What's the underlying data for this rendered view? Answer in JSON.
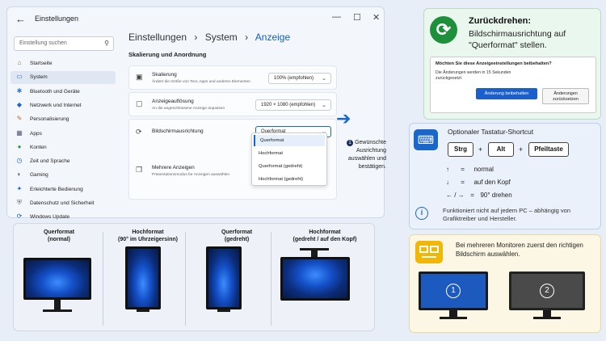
{
  "window": {
    "title": "Einstellungen",
    "back": "←",
    "min": "—",
    "max": "☐",
    "close": "✕"
  },
  "search": {
    "placeholder": "Einstellung suchen",
    "icon": "search-icon"
  },
  "sidebar": {
    "items": [
      {
        "label": "Startseite",
        "icon": "home-icon",
        "color": "#8a6d3b"
      },
      {
        "label": "System",
        "icon": "system-icon",
        "color": "#1a66c9"
      },
      {
        "label": "Bluetooth und Geräte",
        "icon": "bluetooth-icon",
        "color": "#2b7bd6"
      },
      {
        "label": "Netzwerk und Internet",
        "icon": "wifi-icon",
        "color": "#1a66c9"
      },
      {
        "label": "Personalisierung",
        "icon": "brush-icon",
        "color": "#c8662b"
      },
      {
        "label": "Apps",
        "icon": "apps-icon",
        "color": "#5a5a7a"
      },
      {
        "label": "Konten",
        "icon": "account-icon",
        "color": "#2aa052"
      },
      {
        "label": "Zeit und Sprache",
        "icon": "clock-icon",
        "color": "#1a66c9"
      },
      {
        "label": "Gaming",
        "icon": "gamepad-icon",
        "color": "#555"
      },
      {
        "label": "Erleichterte Bedienung",
        "icon": "accessibility-icon",
        "color": "#1a66c9"
      },
      {
        "label": "Datenschutz und Sicherheit",
        "icon": "shield-icon",
        "color": "#6b6b6b"
      },
      {
        "label": "Windows Update",
        "icon": "update-icon",
        "color": "#1a66c9"
      }
    ]
  },
  "breadcrumb": {
    "a": "Einstellungen",
    "sep": "›",
    "b": "System",
    "c": "Anzeige"
  },
  "section_title": "Skalierung und Anordnung",
  "cards": {
    "scale": {
      "title": "Skalierung",
      "desc": "Ändert die Größe von Text, Apps und anderen Elementen",
      "value": "100% (empfohlen)"
    },
    "resolution": {
      "title": "Anzeigeauflösung",
      "desc": "An die angeschlossene Anzeige anpassen",
      "value": "1920 × 1080 (empfohlen)"
    },
    "orientation": {
      "title": "Bildschirmausrichtung",
      "value": "Querformat"
    },
    "multi": {
      "title": "Mehrere Anzeigen",
      "desc": "Präsentationsmodus für Anzeigen auswählen"
    }
  },
  "orientation_menu": [
    "Querformat",
    "Hochformat",
    "Querformat (gedreht)",
    "Hochformat (gedreht)"
  ],
  "step": {
    "num": "1",
    "text": "Gewünschte Ausrichtung auswählen und bestätigen."
  },
  "orient_panel": [
    {
      "title": "Querformat",
      "sub": "(normal)"
    },
    {
      "title": "Hochformat",
      "sub": "(90° im Uhrzeigersinn)"
    },
    {
      "title": "Querformat",
      "sub": "(gedreht)"
    },
    {
      "title": "Hochformat",
      "sub": "(gedreht / auf den Kopf)"
    }
  ],
  "revert": {
    "title": "Zurückdrehen:",
    "text": "Bildschirmausrichtung auf \"Querformat\" stellen.",
    "dialog_q": "Möchten Sie diese Anzeigeeinstellungen beibehalten?",
    "dialog_t": "Die Änderungen werden in 15 Sekunden zurückgesetzt",
    "keep": "Änderung beibehalten",
    "reset": "Änderungen zurücksetzen"
  },
  "shortcut": {
    "title": "Optionaler Tastatur-Shortcut",
    "keys": [
      "Strg",
      "Alt",
      "Pfeiltaste"
    ],
    "plus": "+",
    "map": [
      {
        "k": "↑",
        "eq": "=",
        "v": "normal"
      },
      {
        "k": "↓",
        "eq": "=",
        "v": "auf den Kopf"
      },
      {
        "k": "← / →",
        "eq": "=",
        "v": "90° drehen"
      }
    ],
    "info": "Funktioniert nicht auf jedem PC – abhängig von Grafiktreiber und Hersteller."
  },
  "multi_monitor": {
    "text": "Bei mehreren Monitoren zuerst den richtigen Bildschirm auswählen.",
    "m1": "1",
    "m2": "2"
  },
  "colors": {
    "accent": "#1a66c9",
    "green": "#1e8f3a",
    "yellow": "#f2b705"
  }
}
